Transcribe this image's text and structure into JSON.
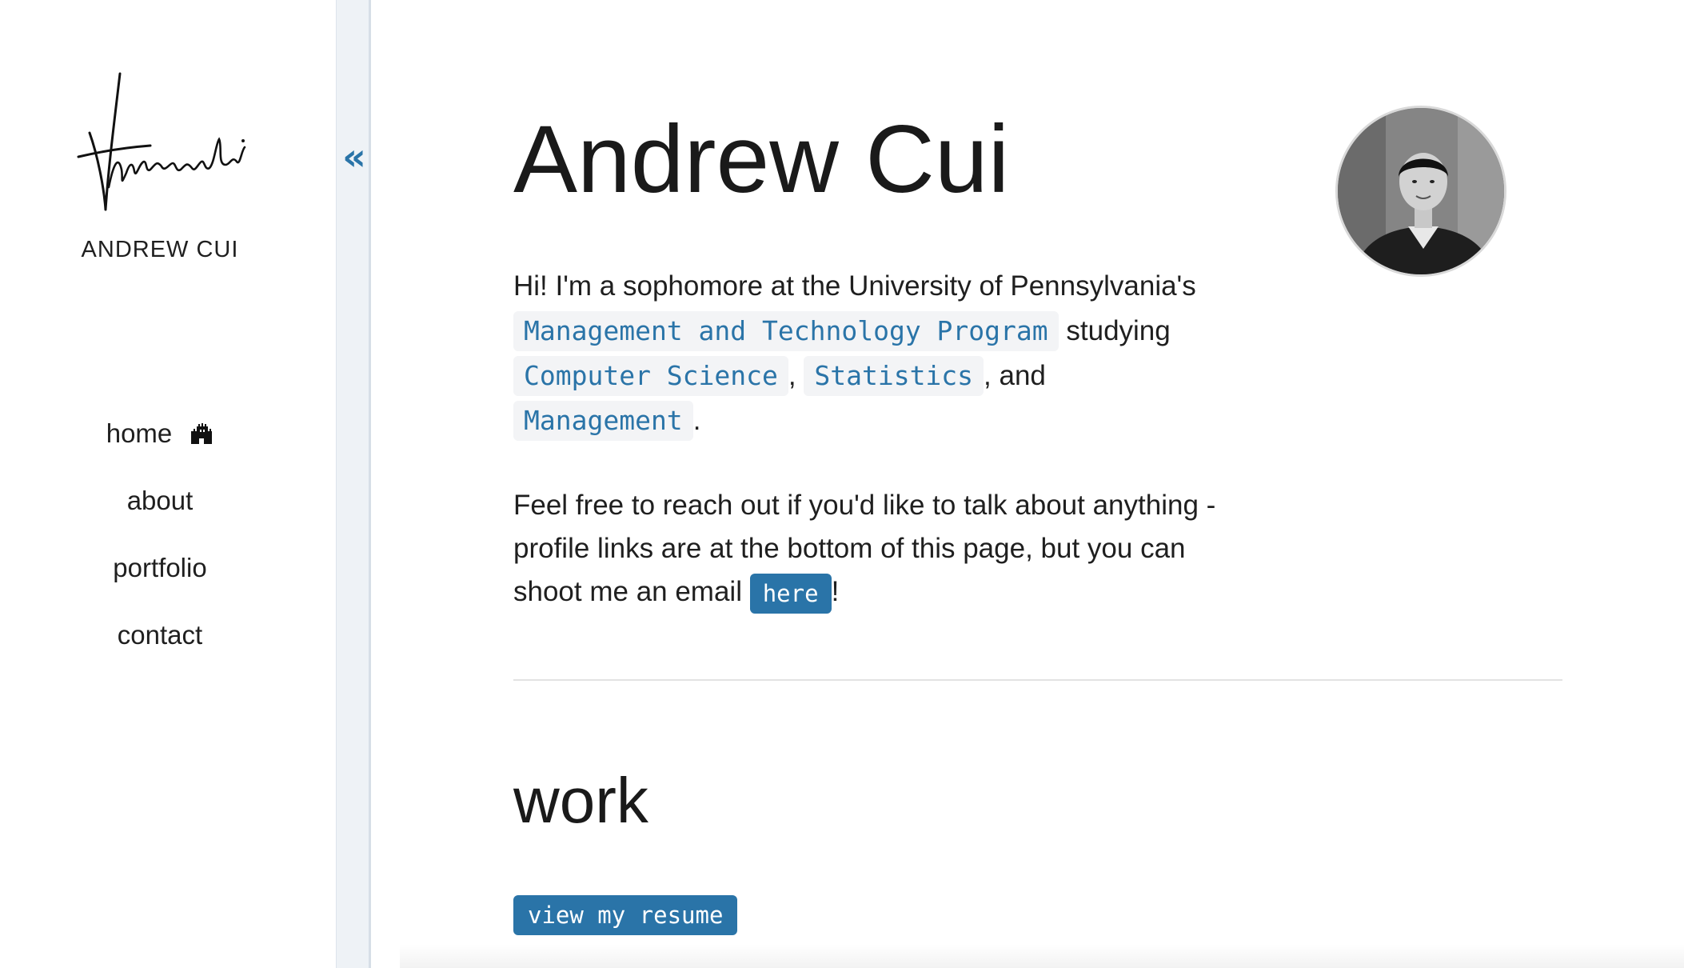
{
  "sidebar": {
    "site_name": "ANDREW CUI",
    "nav": [
      {
        "label": "home",
        "icon": "castle-icon"
      },
      {
        "label": "about"
      },
      {
        "label": "portfolio"
      },
      {
        "label": "contact"
      }
    ]
  },
  "collapse": {
    "glyph": "«"
  },
  "main": {
    "title": "Andrew Cui",
    "intro": {
      "prefix": "Hi! I'm a sophomore at the University of Pennsylvania's",
      "program": "Management and Technology Program",
      "studying": "studying",
      "field1": "Computer Science",
      "comma": ",",
      "field2": "Statistics",
      "and": ", and",
      "field3": "Management",
      "period": "."
    },
    "contact": {
      "text": "Feel free to reach out if you'd like to talk about anything - profile links are at the bottom of this page, but you can shoot me an email",
      "link": "here",
      "suffix": "!"
    },
    "section_title": "work",
    "resume_button": "view my resume"
  },
  "colors": {
    "accent": "#2a74a8",
    "code_bg": "#f3f4f6",
    "strip_bg": "#eef2f6"
  }
}
